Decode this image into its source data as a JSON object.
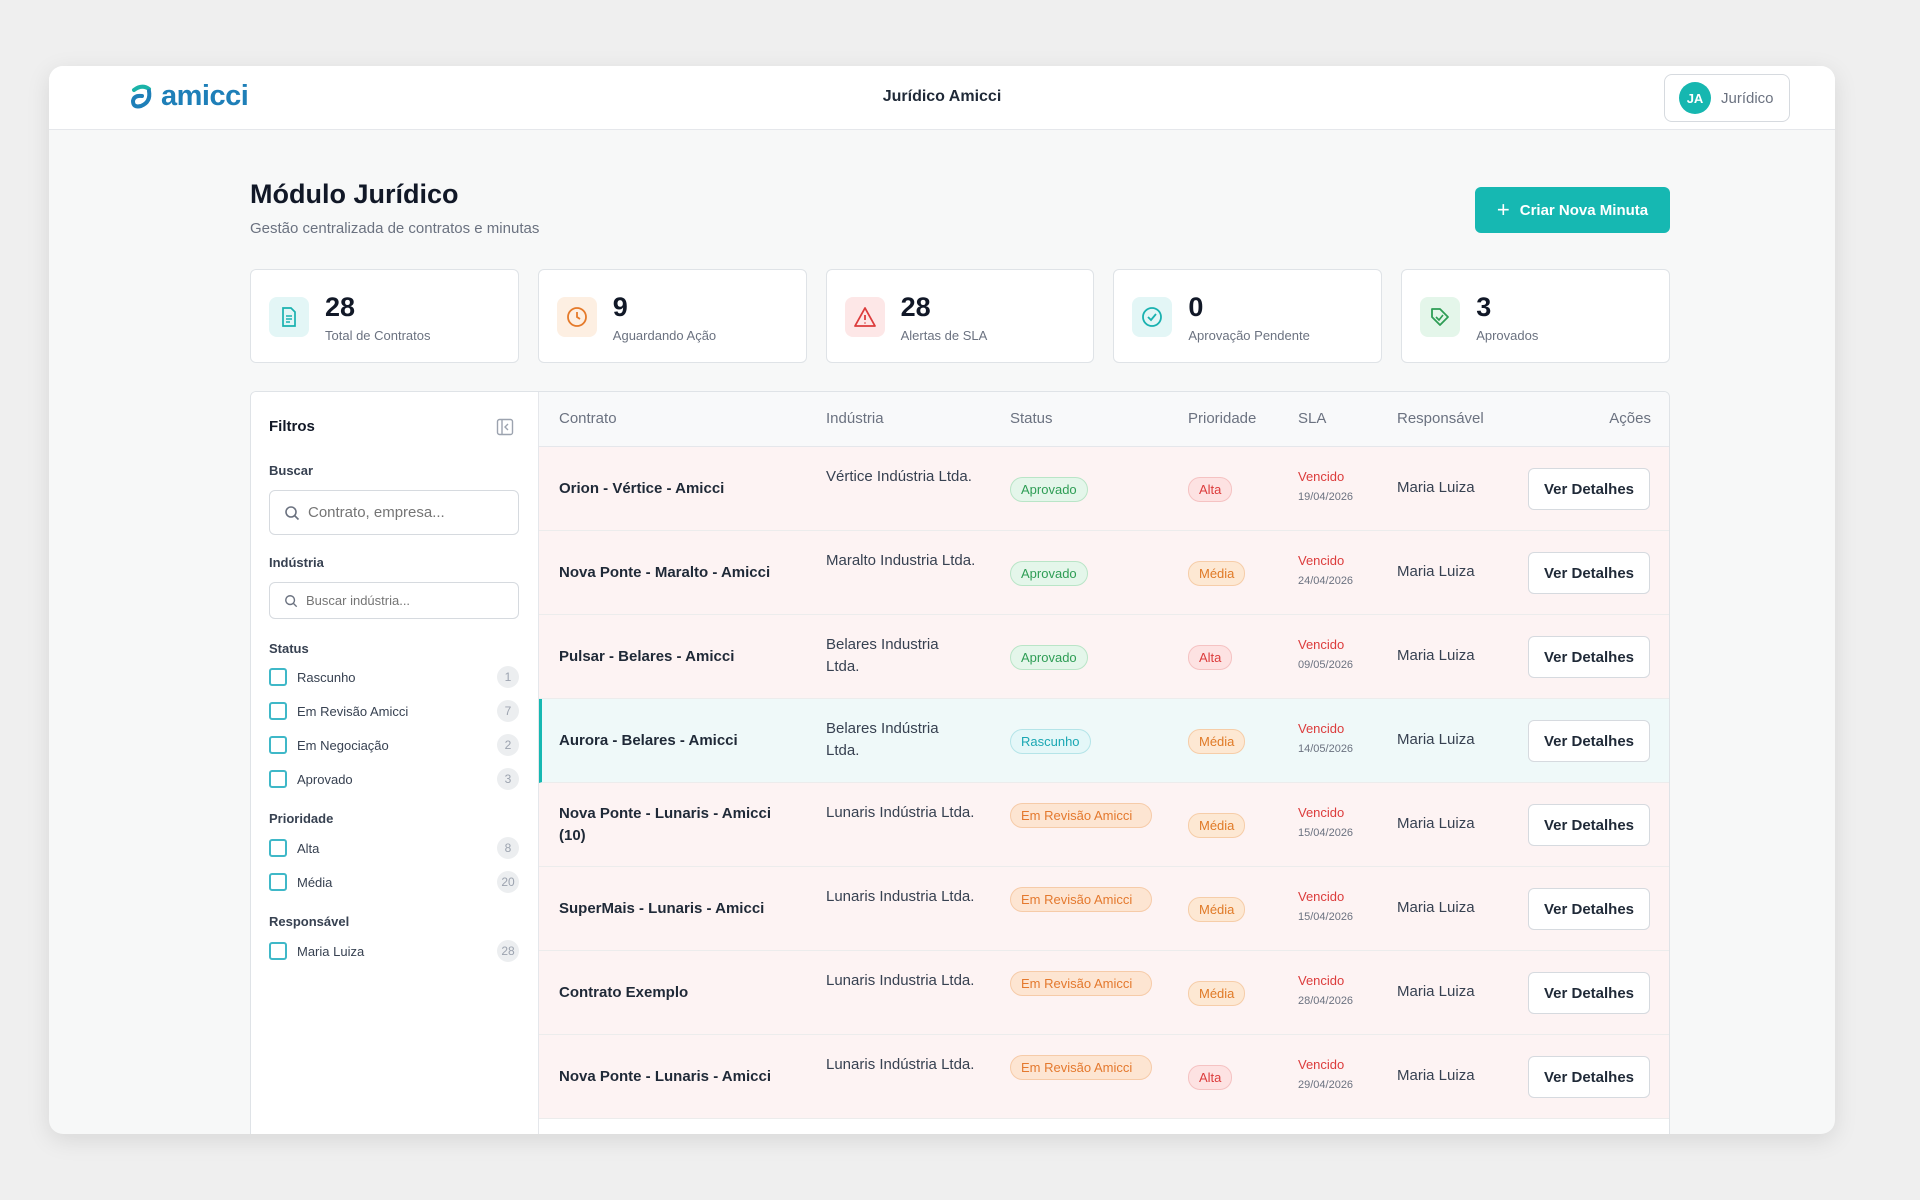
{
  "colors": {
    "accent": "#16b8b2",
    "danger": "#dc3c3c",
    "warning": "#e07a27",
    "success": "#2e9d55",
    "brand": "#1e7fb8"
  },
  "app": {
    "logo_text": "amicci",
    "title": "Jurídico Amicci",
    "user_initials": "JA",
    "user_label": "Jurídico"
  },
  "header": {
    "title": "Módulo Jurídico",
    "subtitle": "Gestão centralizada de contratos e minutas",
    "create_label": "Criar Nova Minuta"
  },
  "stats": [
    {
      "value": "28",
      "label": "Total de Contratos",
      "icon": "document-icon"
    },
    {
      "value": "9",
      "label": "Aguardando Ação",
      "icon": "clock-icon"
    },
    {
      "value": "28",
      "label": "Alertas de SLA",
      "icon": "warning-icon"
    },
    {
      "value": "0",
      "label": "Aprovação Pendente",
      "icon": "check-circle-icon"
    },
    {
      "value": "3",
      "label": "Aprovados",
      "icon": "approved-tag-icon"
    }
  ],
  "filters": {
    "title": "Filtros",
    "search_label": "Buscar",
    "search_placeholder": "Contrato, empresa...",
    "industry_label": "Indústria",
    "industry_placeholder": "Buscar indústria...",
    "status_label": "Status",
    "status_options": [
      {
        "label": "Rascunho",
        "count": "1"
      },
      {
        "label": "Em Revisão Amicci",
        "count": "7"
      },
      {
        "label": "Em Negociação",
        "count": "2"
      },
      {
        "label": "Aprovado",
        "count": "3"
      }
    ],
    "priority_label": "Prioridade",
    "priority_options": [
      {
        "label": "Alta",
        "count": "8"
      },
      {
        "label": "Média",
        "count": "20"
      }
    ],
    "owner_label": "Responsável",
    "owner_options": [
      {
        "label": "Maria Luiza",
        "count": "28"
      }
    ]
  },
  "table": {
    "columns": [
      "Contrato",
      "Indústria",
      "Status",
      "Prioridade",
      "SLA",
      "Responsável",
      "Ações"
    ],
    "action_label": "Ver Detalhes",
    "rows": [
      {
        "contract": "Orion - Vértice - Amicci",
        "industry": "Vértice Indústria Ltda.",
        "status": "Aprovado",
        "priority": "Alta",
        "sla": "Vencido",
        "sla_date": "19/04/2026",
        "owner": "Maria Luiza"
      },
      {
        "contract": "Nova Ponte - Maralto - Amicci",
        "industry": "Maralto Industria Ltda.",
        "status": "Aprovado",
        "priority": "Média",
        "sla": "Vencido",
        "sla_date": "24/04/2026",
        "owner": "Maria Luiza"
      },
      {
        "contract": "Pulsar - Belares - Amicci",
        "industry": "Belares Industria Ltda.",
        "status": "Aprovado",
        "priority": "Alta",
        "sla": "Vencido",
        "sla_date": "09/05/2026",
        "owner": "Maria Luiza"
      },
      {
        "contract": "Aurora - Belares - Amicci",
        "industry": "Belares Indústria Ltda.",
        "status": "Rascunho",
        "priority": "Média",
        "sla": "Vencido",
        "sla_date": "14/05/2026",
        "owner": "Maria Luiza"
      },
      {
        "contract": "Nova Ponte - Lunaris - Amicci (10)",
        "industry": "Lunaris Indústria Ltda.",
        "status": "Em Revisão Amicci",
        "priority": "Média",
        "sla": "Vencido",
        "sla_date": "15/04/2026",
        "owner": "Maria Luiza"
      },
      {
        "contract": "SuperMais - Lunaris - Amicci",
        "industry": "Lunaris Industria Ltda.",
        "status": "Em Revisão Amicci",
        "priority": "Média",
        "sla": "Vencido",
        "sla_date": "15/04/2026",
        "owner": "Maria Luiza"
      },
      {
        "contract": "Contrato Exemplo",
        "industry": "Lunaris Industria Ltda.",
        "status": "Em Revisão Amicci",
        "priority": "Média",
        "sla": "Vencido",
        "sla_date": "28/04/2026",
        "owner": "Maria Luiza"
      },
      {
        "contract": "Nova Ponte - Lunaris - Amicci",
        "industry": "Lunaris Indústria Ltda.",
        "status": "Em Revisão Amicci",
        "priority": "Alta",
        "sla": "Vencido",
        "sla_date": "29/04/2026",
        "owner": "Maria Luiza"
      }
    ]
  }
}
